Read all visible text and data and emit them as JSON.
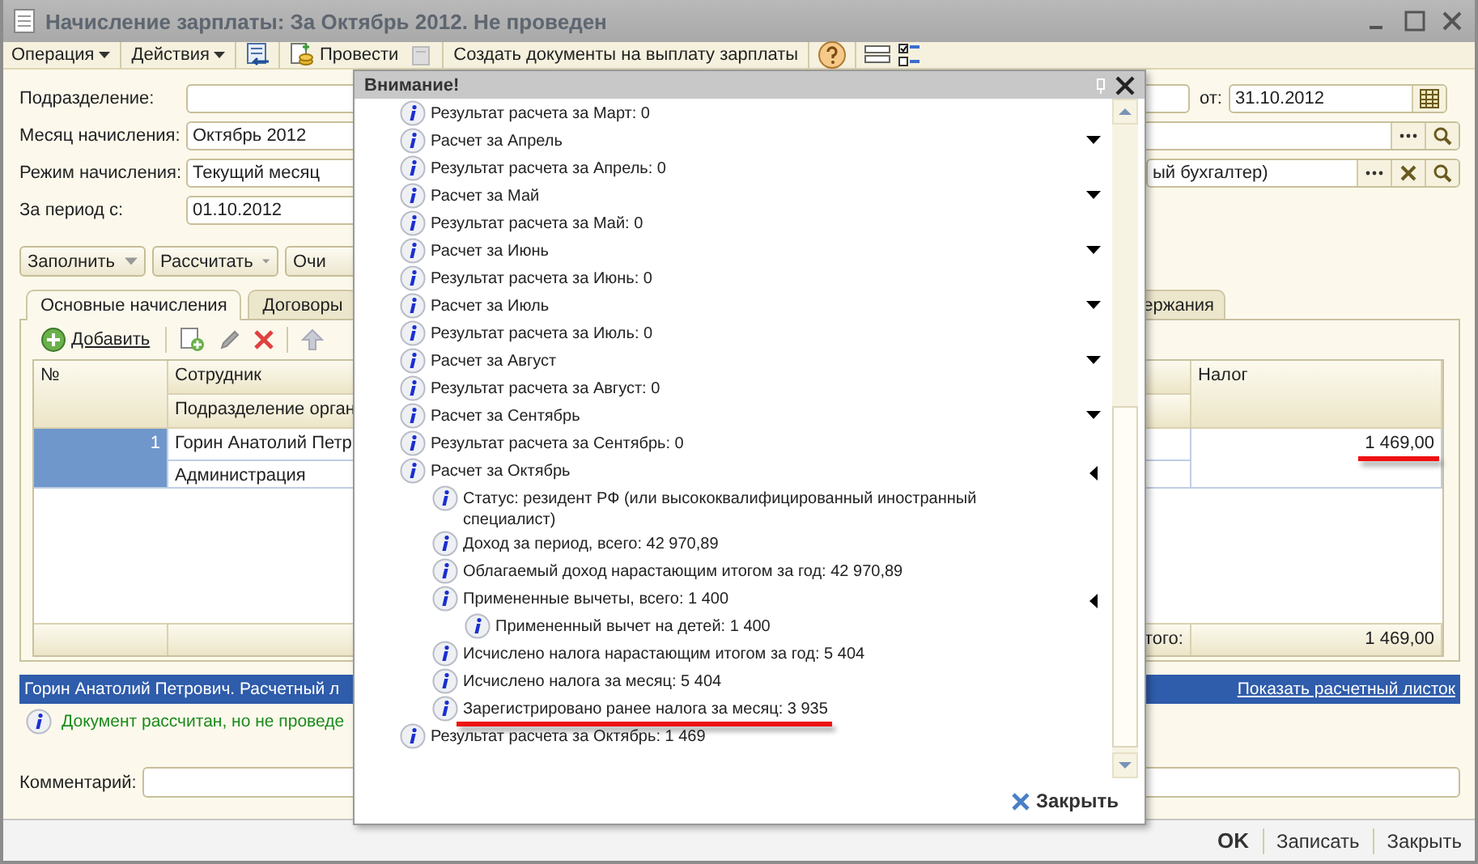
{
  "window": {
    "title": "Начисление зарплаты: За Октябрь 2012. Не проведен"
  },
  "toolbar": {
    "operation": "Операция",
    "actions": "Действия",
    "post": "Провести",
    "create": "Создать документы на выплату зарплаты"
  },
  "form": {
    "division_label": "Подразделение:",
    "date_label": "от:",
    "date": "31.10.2012",
    "month_label": "Месяц начисления:",
    "month": "Октябрь 2012",
    "mode_label": "Режим начисления:",
    "mode": "Текущий месяц",
    "responsible": "ый бухгалтер)",
    "period_label": "За период с:",
    "period_from": "01.10.2012"
  },
  "buttons": [
    {
      "label": "Заполнить",
      "kind": "dropdown"
    },
    {
      "label": "Рассчитать",
      "kind": "dropdown"
    },
    {
      "label": "Очи",
      "kind": "plain"
    }
  ],
  "tabs": [
    {
      "label": "Основные начисления",
      "selected": true
    },
    {
      "label": "Договоры",
      "selected": false
    },
    {
      "label": "ержания",
      "selected": false
    }
  ],
  "table_toolbar": {
    "add": "Добавить"
  },
  "table": {
    "columns": {
      "number": "№",
      "employee": "Сотрудник",
      "department": "Подразделение орган",
      "tax": "Налог"
    },
    "rows": [
      {
        "number": "1",
        "employee": "Горин Анатолий Петр",
        "department": "Администрация",
        "tax": "1 469,00",
        "selected": true,
        "tax_marked": true
      }
    ],
    "footer": {
      "label": "того:",
      "tax": "1 469,00"
    }
  },
  "status_bar": {
    "text": "Горин Анатолий Петрович. Расчетный л",
    "link": "Показать расчетный листок"
  },
  "message": "Документ рассчитан, но не проведе",
  "comment_label": "Комментарий:",
  "bottom_buttons": [
    {
      "label": "OK",
      "default": true
    },
    {
      "label": "Записать",
      "default": false
    },
    {
      "label": "Закрыть",
      "default": false
    }
  ],
  "popup": {
    "title": "Внимание!",
    "close": "Закрыть",
    "items": [
      {
        "text": "Результат расчета за Март: 0",
        "marked": false
      },
      {
        "text": "Расчет за Апрель",
        "marked": false,
        "expanded": false
      },
      {
        "text": "Результат расчета за Апрель: 0",
        "marked": false
      },
      {
        "text": "Расчет за Май",
        "marked": false,
        "expanded": false
      },
      {
        "text": "Результат расчета за Май: 0",
        "marked": false
      },
      {
        "text": "Расчет за Июнь",
        "marked": false,
        "expanded": false
      },
      {
        "text": "Результат расчета за Июнь: 0",
        "marked": false
      },
      {
        "text": "Расчет за Июль",
        "marked": false,
        "expanded": false
      },
      {
        "text": "Результат расчета за Июль: 0",
        "marked": false
      },
      {
        "text": "Расчет за Август",
        "marked": false,
        "expanded": false
      },
      {
        "text": "Результат расчета за Август: 0",
        "marked": false
      },
      {
        "text": "Расчет за Сентябрь",
        "marked": false,
        "expanded": false
      },
      {
        "text": "Результат расчета за Сентябрь: 0",
        "marked": false
      },
      {
        "text": "Расчет за Октябрь",
        "marked": false,
        "expanded": true,
        "children": [
          {
            "text": "Статус: резидент РФ (или высококвалифицированный иностранный специалист)",
            "marked": false
          },
          {
            "text": "Доход за период, всего: 42 970,89",
            "marked": false
          },
          {
            "text": "Облагаемый доход нарастающим итогом за год: 42 970,89",
            "marked": false
          },
          {
            "text": "Примененные вычеты, всего: 1 400",
            "marked": false,
            "expanded": true,
            "children": [
              {
                "text": "Примененный вычет на детей: 1 400",
                "marked": false
              }
            ]
          },
          {
            "text": "Исчислено налога нарастающим итогом за год: 5 404",
            "marked": false
          },
          {
            "text": "Исчислено налога за месяц: 5 404",
            "marked": false
          },
          {
            "text": "Зарегистрировано ранее налога за месяц: 3 935",
            "marked": true
          }
        ]
      },
      {
        "text": "Результат расчета за Октябрь: 1 469",
        "marked": false
      }
    ]
  }
}
